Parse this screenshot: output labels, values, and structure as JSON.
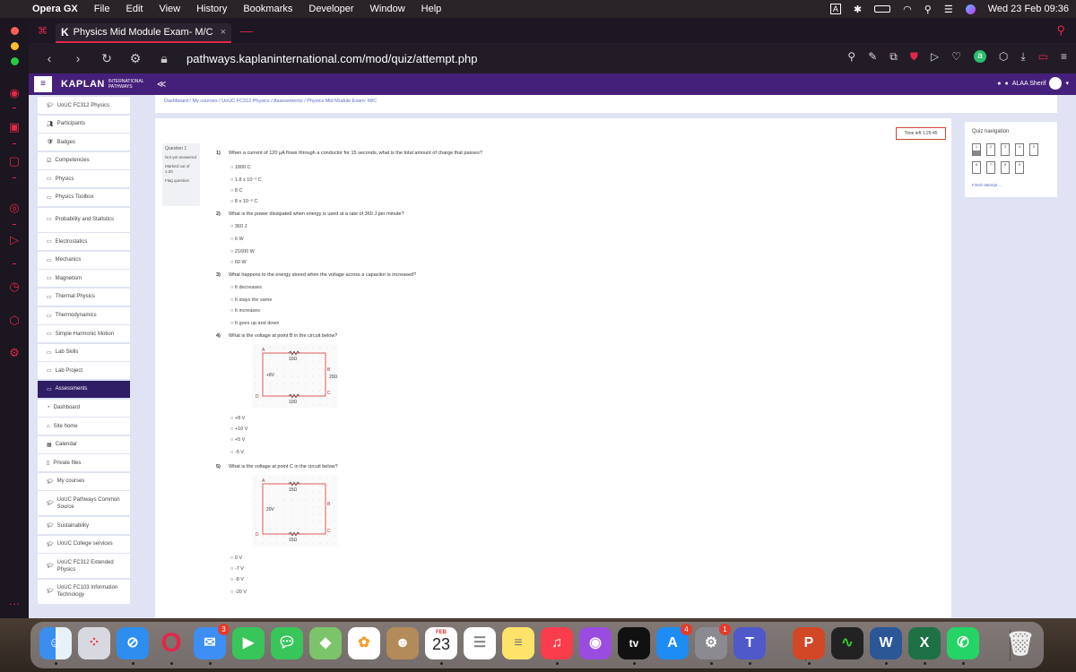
{
  "menubar": {
    "app": "Opera GX",
    "items": [
      "File",
      "Edit",
      "View",
      "History",
      "Bookmarks",
      "Developer",
      "Window",
      "Help"
    ],
    "input_source": "A",
    "clock": "Wed 23 Feb 09:36"
  },
  "browser": {
    "tab_title": "Physics Mid Module Exam- M/C",
    "tab_logo": "K",
    "url": "pathways.kaplaninternational.com/mod/quiz/attempt.php"
  },
  "kaplan": {
    "logo": "KAPLAN",
    "intl": "INTERNATIONAL PATHWAYS",
    "user_name": "ALAA Sherif"
  },
  "breadcrumb": "Dashboard / My courses / UoUC FC312 Physics / Assessments / Physics Mid Module Exam- M/C",
  "drawer": [
    {
      "icon": "cap",
      "label": "UoUC FC312 Physics"
    },
    {
      "icon": "users",
      "label": "Participants"
    },
    {
      "icon": "badge",
      "label": "Badges"
    },
    {
      "icon": "check",
      "label": "Competencies"
    },
    {
      "icon": "folder",
      "label": "Physics"
    },
    {
      "icon": "folder",
      "label": "Physics Toolbox"
    },
    {
      "icon": "folder",
      "label": "Probability and Statistics",
      "tall": true
    },
    {
      "icon": "folder",
      "label": "Electrostatics"
    },
    {
      "icon": "folder",
      "label": "Mechanics"
    },
    {
      "icon": "folder",
      "label": "Magnetism"
    },
    {
      "icon": "folder",
      "label": "Thermal Physics"
    },
    {
      "icon": "folder",
      "label": "Thermodynamics"
    },
    {
      "icon": "folder",
      "label": "Simple Harmonic Motion"
    },
    {
      "icon": "folder",
      "label": "Lab Skills"
    },
    {
      "icon": "folder",
      "label": "Lab Project"
    },
    {
      "icon": "folder",
      "label": "Assessments",
      "active": true
    },
    {
      "icon": "dashboard",
      "label": "Dashboard"
    },
    {
      "icon": "home",
      "label": "Site home"
    },
    {
      "icon": "calendar",
      "label": "Calendar"
    },
    {
      "icon": "file",
      "label": "Private files"
    },
    {
      "icon": "cap",
      "label": "My courses"
    },
    {
      "icon": "cap",
      "label": "UoUC Pathways Common Source",
      "tall": true
    },
    {
      "icon": "cap",
      "label": "Sustainability"
    },
    {
      "icon": "cap",
      "label": "UoUC College services"
    },
    {
      "icon": "cap",
      "label": "UoUC FC312 Extended Physics",
      "tall": true
    },
    {
      "icon": "cap",
      "label": "UoUC FC103 Information Technology",
      "tall": true
    }
  ],
  "quiz": {
    "timer": "Time left 1:29:45",
    "info": {
      "question_label": "Question 1",
      "status": "Not yet answered",
      "marked": "Marked out of 1.00",
      "flag": "Flag question"
    },
    "questions": [
      {
        "num": "1)",
        "text": "When a current of 120 μA flows through a conductor for 15 seconds, what is the total amount of charge that passes?",
        "options": [
          "1800 C",
          "1.8 x 10⁻³ C",
          "8 C",
          "8 x 10⁻⁶ C"
        ]
      },
      {
        "num": "2)",
        "text": "What is the power dissipated when energy is used at a rate of 360 J per minute?",
        "options": [
          "360 J",
          "6 W",
          "21600 W",
          "60 W"
        ]
      },
      {
        "num": "3)",
        "text": "What happens to the energy stored when the voltage across a capacitor is increased?",
        "options": [
          "It decreases",
          "It stays the same",
          "It increases",
          "It goes up and down"
        ]
      },
      {
        "num": "4)",
        "text": "What is the voltage at point B in the circuit below?",
        "options": [
          "+8 V",
          "+10 V",
          "+5 V",
          "-5 V"
        ],
        "circuit": {
          "nodes": [
            "A",
            "B",
            "C",
            "D"
          ],
          "resistors": [
            "10Ω",
            "20Ω",
            "10Ω"
          ],
          "source": "+8V"
        }
      },
      {
        "num": "5)",
        "text": "What is the voltage at point C in the circuit below?",
        "options": [
          "0 V",
          "-7 V",
          "-8 V",
          "-20 V"
        ],
        "circuit": {
          "nodes": [
            "A",
            "B",
            "C",
            "D"
          ],
          "resistors": [
            "15Ω",
            "15Ω"
          ],
          "source": "20V"
        }
      }
    ]
  },
  "quiz_nav": {
    "title": "Quiz navigation",
    "numbers": [
      "1",
      "2",
      "3",
      "4",
      "5",
      "6",
      "7",
      "8",
      "9"
    ],
    "finish": "Finish attempt ..."
  },
  "dock": {
    "mail_badge": "3",
    "calendar_month": "FEB",
    "calendar_day": "23",
    "appstore_badge": "4",
    "settings_badge": "1"
  }
}
